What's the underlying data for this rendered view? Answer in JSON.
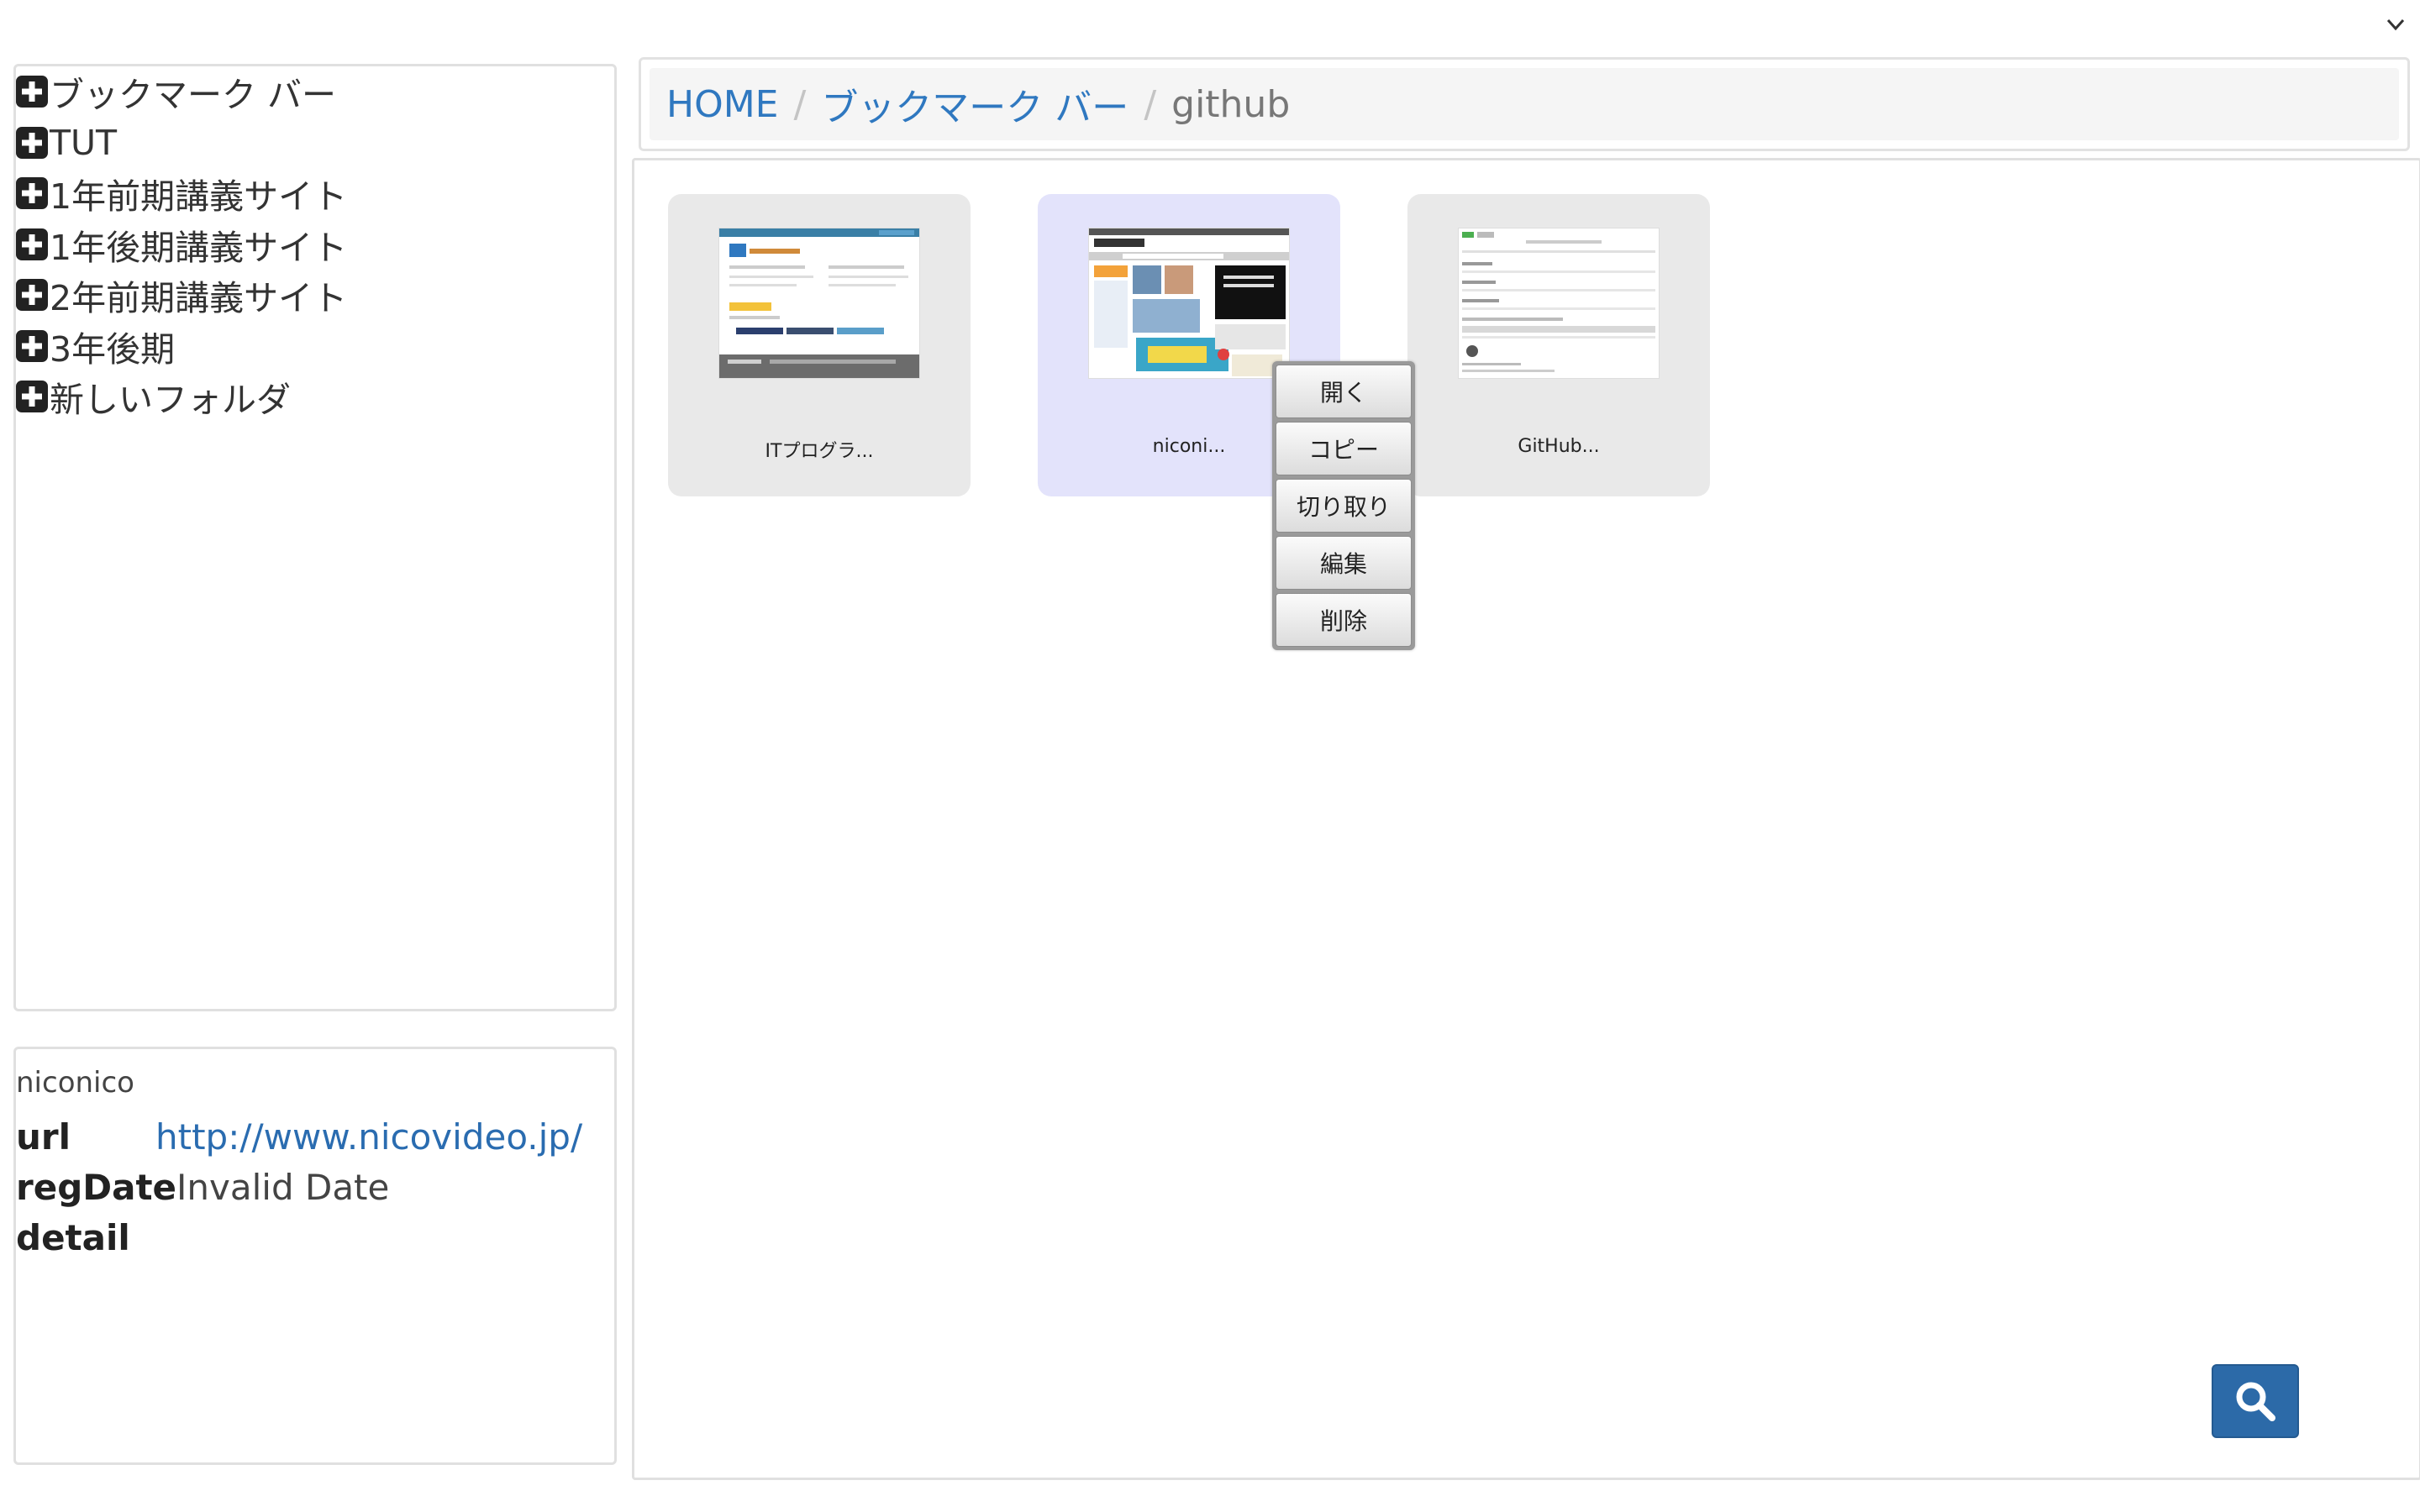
{
  "tree": {
    "items": [
      {
        "label": "ブックマーク バー"
      },
      {
        "label": "TUT"
      },
      {
        "label": "1年前期講義サイト"
      },
      {
        "label": "1年後期講義サイト"
      },
      {
        "label": "2年前期講義サイト"
      },
      {
        "label": "3年後期"
      },
      {
        "label": "新しいフォルダ"
      }
    ]
  },
  "breadcrumb": {
    "home": "HOME",
    "folder": "ブックマーク バー",
    "separator": "/",
    "current": "github"
  },
  "cards": [
    {
      "label": "ITプログラ..."
    },
    {
      "label": "niconi..."
    },
    {
      "label": "GitHub..."
    }
  ],
  "context_menu": {
    "items": [
      "開く",
      "コピー",
      "切り取り",
      "編集",
      "削除"
    ]
  },
  "detail": {
    "title": "niconico",
    "url_key": "url",
    "url_value": "http://www.nicovideo.jp/",
    "regdate_key": "regDate",
    "regdate_value": "Invalid Date",
    "detail_key": "detail"
  },
  "colors": {
    "link": "#2f78c0",
    "selected_card": "#e3e3fb",
    "search_button": "#2c6aa8"
  }
}
